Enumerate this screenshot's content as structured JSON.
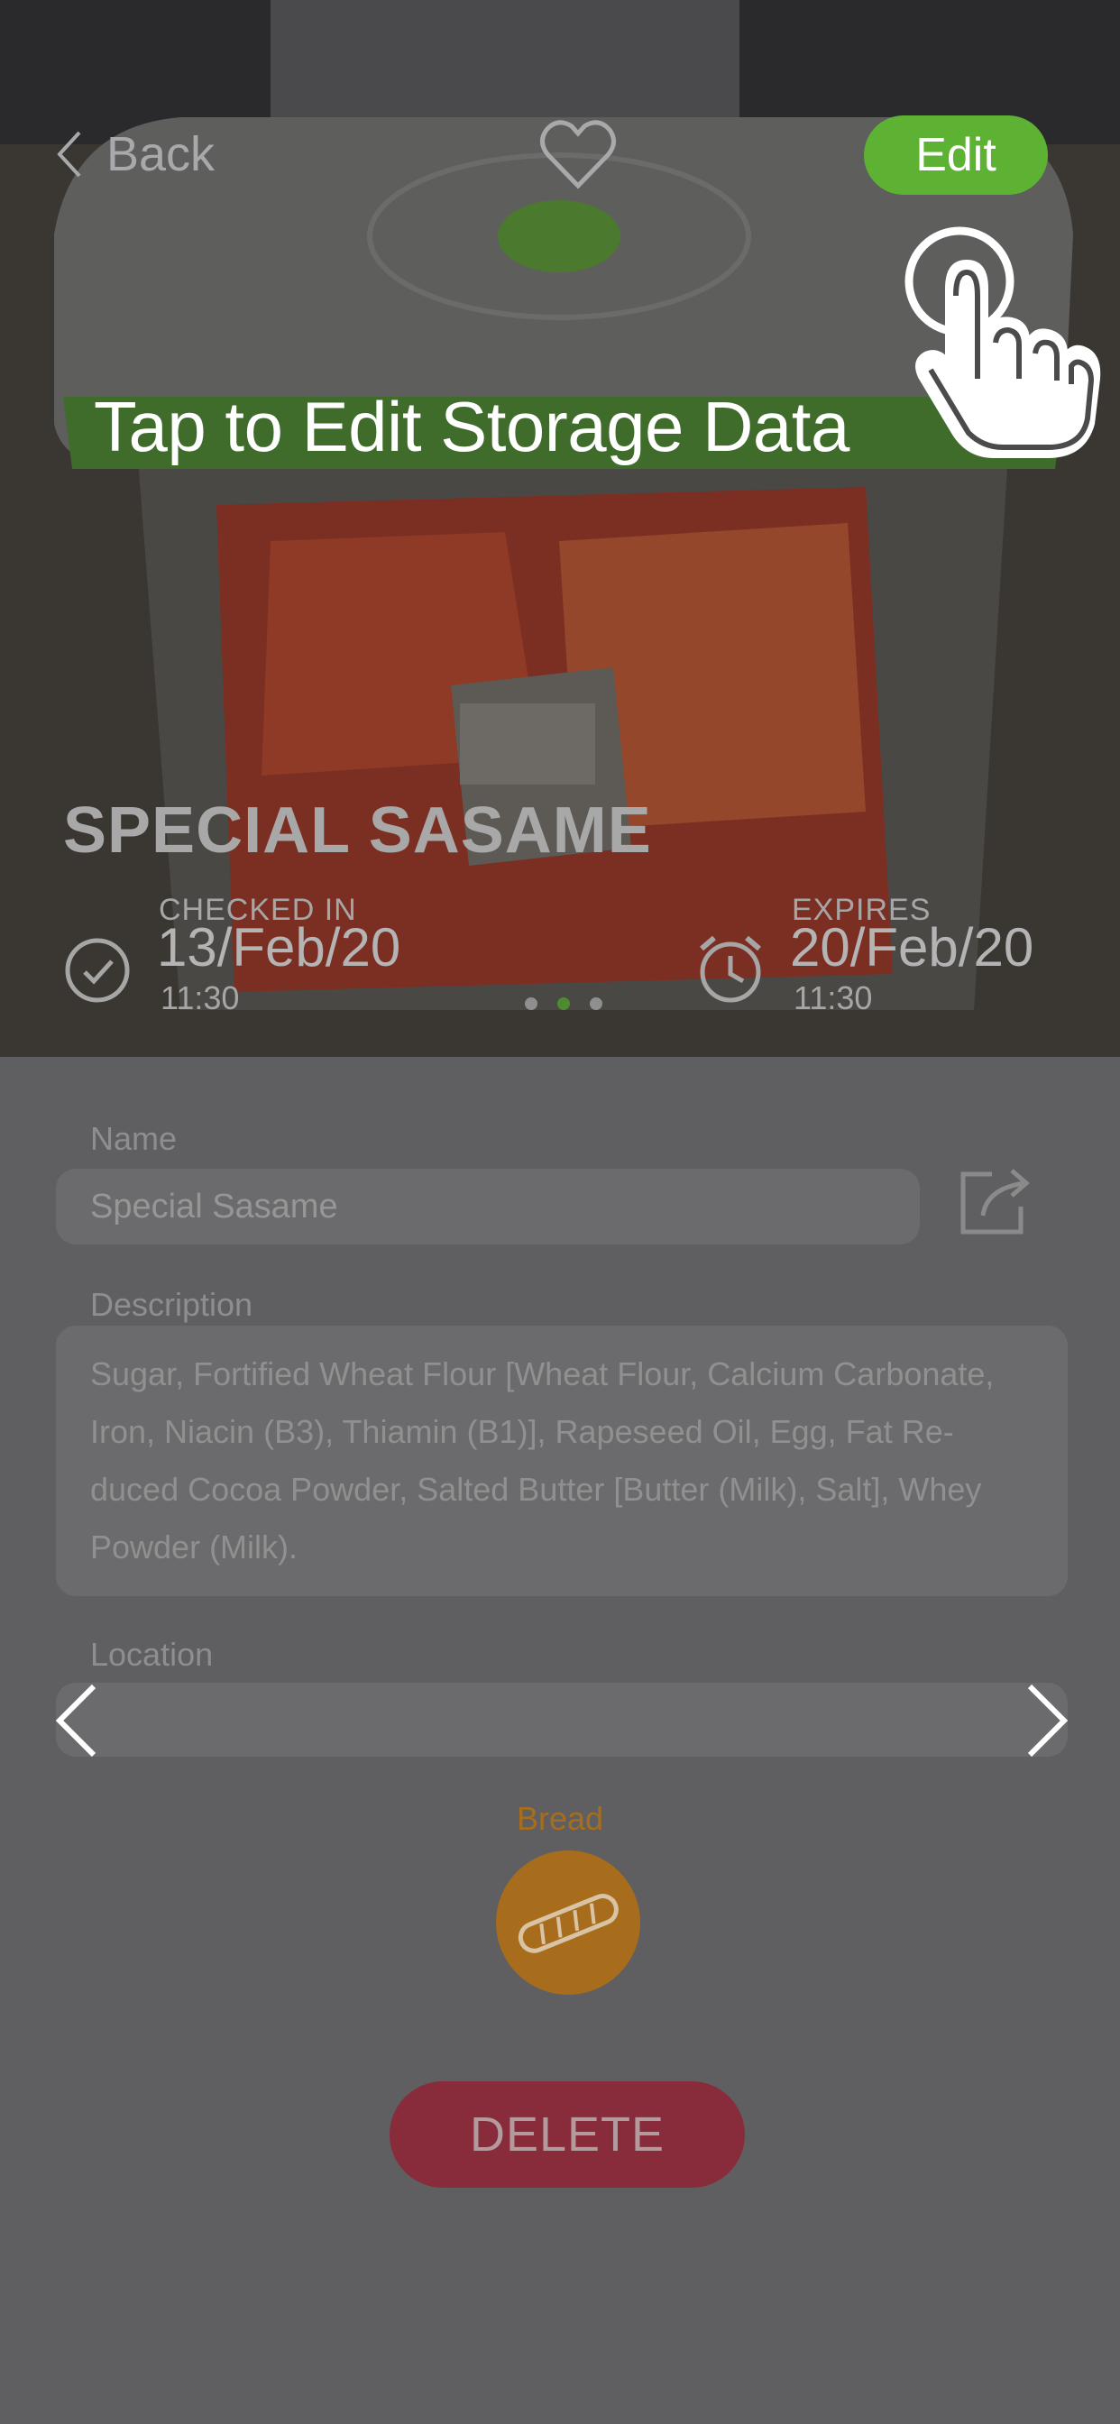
{
  "header": {
    "back_label": "Back",
    "edit_label": "Edit",
    "favorite_icon": "heart-icon",
    "edit_color": "#5db233"
  },
  "hint": {
    "text": "Tap to Edit Storage Data",
    "icon": "tap-hand-icon"
  },
  "item": {
    "title": "SPECIAL SASAME",
    "checked_in": {
      "label": "CHECKED IN",
      "date": "13/Feb/20",
      "time": "11:30",
      "icon": "clock-icon"
    },
    "expires": {
      "label": "EXPIRES",
      "date": "20/Feb/20",
      "time": "11:30",
      "icon": "alarm-clock-icon"
    },
    "photo_pages": {
      "count": 3,
      "active": 2
    }
  },
  "form": {
    "name_label": "Name",
    "name_value": "Special Sasame",
    "description_label": "Description",
    "description_lines": [
      "Sugar, Fortified Wheat Flour [Wheat Flour, Calcium Carbonate,",
      "Iron, Niacin (B3), Thiamin (B1)], Rapeseed Oil, Egg, Fat Re-",
      "duced Cocoa Powder, Salted Butter [Butter (Milk), Salt], Whey",
      "Powder (Milk)."
    ],
    "location_label": "Location"
  },
  "category": {
    "label": "Bread",
    "icon": "bread-icon",
    "color": "#a86d1c"
  },
  "actions": {
    "delete_label": "DELETE",
    "delete_color": "#882b3a"
  }
}
